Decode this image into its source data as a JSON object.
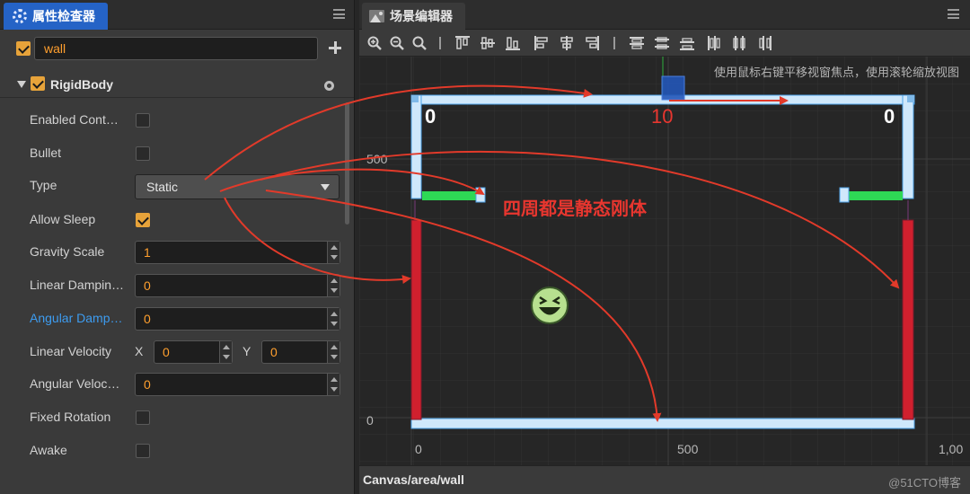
{
  "inspector": {
    "tab_title": "属性检查器",
    "node_name": "wall",
    "component": {
      "title": "RigidBody",
      "props": {
        "enabled_contact": {
          "label": "Enabled Cont…",
          "checked": false
        },
        "bullet": {
          "label": "Bullet",
          "checked": false
        },
        "type": {
          "label": "Type",
          "value": "Static"
        },
        "allow_sleep": {
          "label": "Allow Sleep",
          "checked": true
        },
        "gravity_scale": {
          "label": "Gravity Scale",
          "value": "1"
        },
        "linear_damping": {
          "label": "Linear Dampin…",
          "value": "0"
        },
        "angular_damping": {
          "label": "Angular Damp…",
          "value": "0"
        },
        "linear_velocity": {
          "label": "Linear Velocity",
          "x_label": "X",
          "x": "0",
          "y_label": "Y",
          "y": "0"
        },
        "angular_velocity": {
          "label": "Angular Veloc…",
          "value": "0"
        },
        "fixed_rotation": {
          "label": "Fixed Rotation",
          "checked": false
        },
        "awake": {
          "label": "Awake",
          "checked": false
        }
      }
    }
  },
  "scene": {
    "tab_title": "场景编辑器",
    "hint": "使用鼠标右键平移视窗焦点，使用滚轮缩放视图",
    "ruler": {
      "y500": "500",
      "y0": "0",
      "x0": "0",
      "x500": "500",
      "x1000": "1,00"
    },
    "score_left": "0",
    "score_center": "10",
    "score_right": "0",
    "annotation": "四周都是静态刚体",
    "path": "Canvas/area/wall",
    "watermark": "@51CTO博客"
  },
  "colors": {
    "accent": "#2563c6",
    "checkbox": "#e7a33a",
    "field_text": "#ff9f2e",
    "wall": "#cfe8fb",
    "paddle": "#d0202e",
    "green_bar": "#2ed855",
    "arrow": "#e23a2a"
  },
  "icons": [
    "gear-icon",
    "menu-icon",
    "plus-icon",
    "chevron-down-icon",
    "cog-icon",
    "image-icon",
    "zoom-in-icon",
    "zoom-out-icon",
    "zoom-reset-icon",
    "align-icon",
    "smile-emoji-icon"
  ]
}
